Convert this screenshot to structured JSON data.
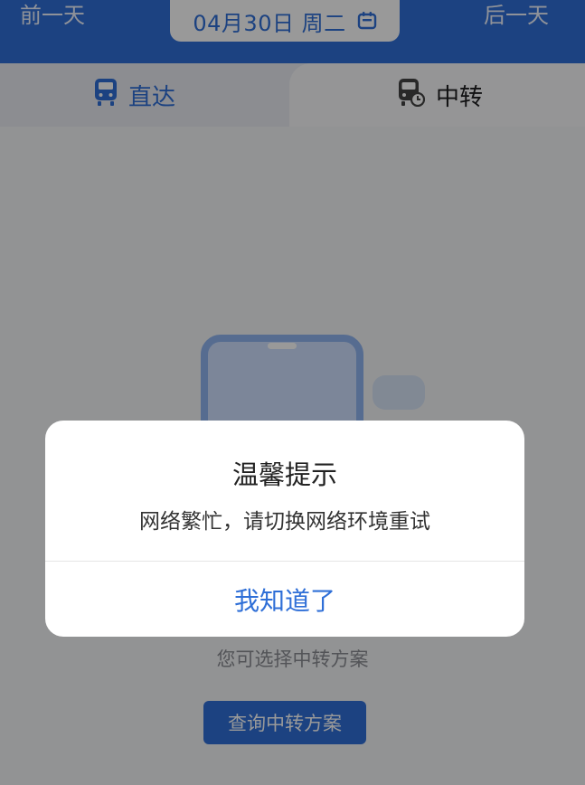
{
  "header": {
    "prev_day": "前一天",
    "next_day": "后一天",
    "date": "04月30日 周二",
    "calendar_icon": "calendar-icon"
  },
  "tabs": [
    {
      "label": "直达",
      "icon": "train-icon",
      "active": true
    },
    {
      "label": "中转",
      "icon": "transfer-train-icon",
      "active": false
    }
  ],
  "empty_state": {
    "hint": "您可选择中转方案",
    "button_label": "查询中转方案"
  },
  "dialog": {
    "title": "温馨提示",
    "message": "网络繁忙，请切换网络环境重试",
    "confirm_label": "我知道了"
  },
  "colors": {
    "accent": "#2f6fd7",
    "overlay": "rgba(0,0,0,0.40)"
  }
}
